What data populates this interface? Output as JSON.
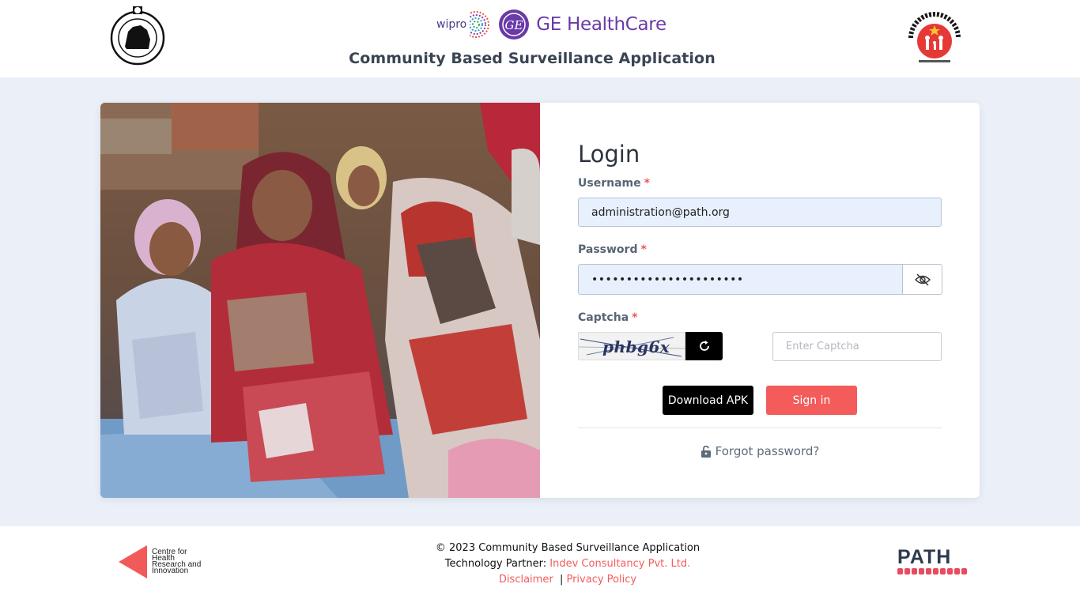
{
  "header": {
    "app_title": "Community Based Surveillance Application",
    "wipro_label": "wipro",
    "ge_label": "GE HealthCare",
    "ge_monogram": "GE"
  },
  "login": {
    "title": "Login",
    "username_label": "Username",
    "username_value": "administration@path.org",
    "password_label": "Password",
    "password_value": "••••••••••••••••••••••",
    "captcha_label": "Captcha",
    "captcha_text": "phbg6x",
    "captcha_placeholder": "Enter Captcha",
    "required_mark": "*",
    "download_label": "Download APK",
    "signin_label": "Sign in",
    "forgot_label": "Forgot password?"
  },
  "footer": {
    "copyright": "© 2023 Community Based Surveillance Application",
    "tech_partner_prefix": "Technology Partner:",
    "tech_partner_name": "Indev Consultancy Pvt. Ltd.",
    "disclaimer": "Disclaimer",
    "separator": "|",
    "privacy": "Privacy Policy",
    "chri_lines": [
      "Centre for",
      "Health",
      "Research and",
      "Innovation"
    ],
    "path_word": "PATH"
  },
  "colors": {
    "accent": "#f45b5b",
    "background": "#eaeff8",
    "input_fill": "#e8f0fe",
    "title_text": "#2c3340"
  },
  "icons": [
    "odisha-emblem-icon",
    "wipro-logo-icon",
    "ge-logo-icon",
    "nhm-logo-icon",
    "eye-slash-icon",
    "refresh-icon",
    "unlock-icon",
    "chri-logo-icon",
    "path-logo-icon"
  ]
}
